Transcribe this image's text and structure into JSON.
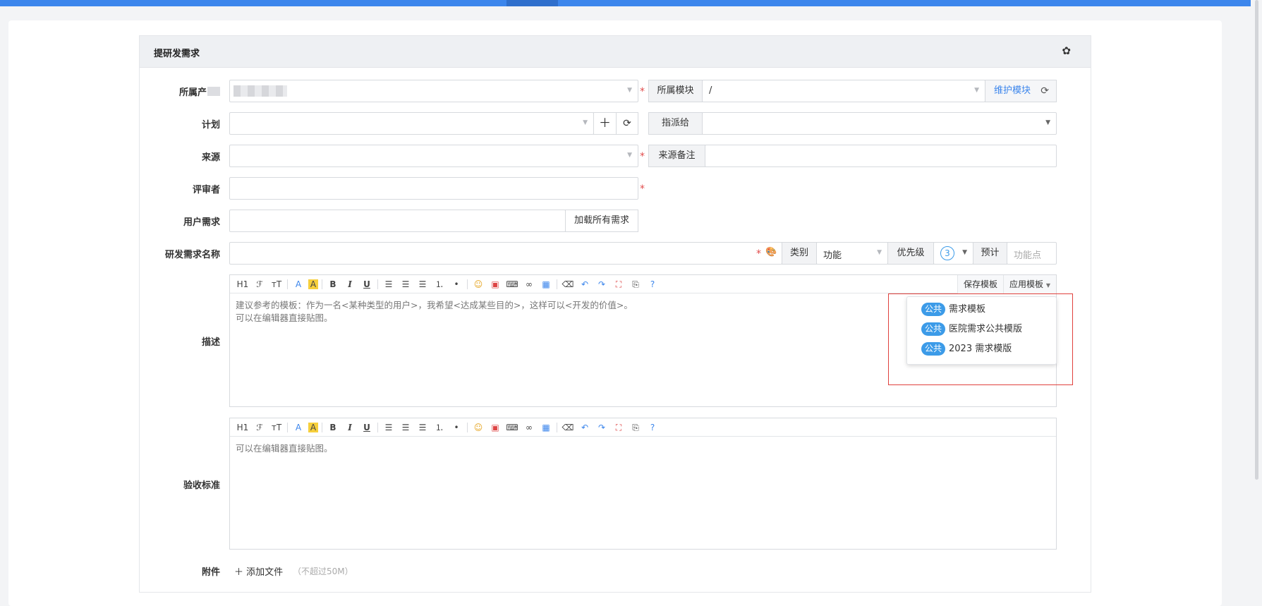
{
  "form": {
    "title": "提研发需求",
    "product_label": "所属产",
    "module_label": "所属模块",
    "module_value": "/",
    "maintain_module": "维护模块",
    "plan_label": "计划",
    "assign_label": "指派给",
    "source_label": "来源",
    "source_note_label": "来源备注",
    "reviewer_label": "评审者",
    "user_req_label": "用户需求",
    "load_all_req": "加载所有需求",
    "name_label": "研发需求名称",
    "category_label": "类别",
    "category_value": "功能",
    "priority_label": "优先级",
    "priority_value": "3",
    "estimate_label": "预计",
    "estimate_placeholder": "功能点",
    "desc_label": "描述",
    "desc_text_1": "建议参考的模板：作为一名<某种类型的用户>，我希望<达成某些目的>，这样可以<开发的价值>。",
    "desc_text_2": "可以在编辑器直接贴图。",
    "save_template": "保存模板",
    "apply_template": "应用模板",
    "accept_label": "验收标准",
    "accept_text": "可以在编辑器直接贴图。",
    "attach_label": "附件",
    "add_file": "添加文件",
    "add_file_hint": "（不超过50M）"
  },
  "template_menu": [
    {
      "badge": "公共",
      "name": "需求模板"
    },
    {
      "badge": "公共",
      "name": "医院需求公共模版"
    },
    {
      "badge": "公共",
      "name": "2023 需求模版"
    }
  ],
  "toolbar": {
    "h1": "H1",
    "font": "ℱ",
    "size": "тT",
    "color": "A",
    "bg": "A",
    "bold": "B",
    "italic": "I",
    "underline": "U"
  },
  "icons": {
    "gear": "gear-icon",
    "plus": "plus-icon",
    "refresh": "refresh-icon",
    "palette": "palette-icon"
  },
  "colors": {
    "accent": "#3c86ec",
    "badge": "#3c9be8",
    "required": "#e14d4d",
    "highlight_box": "#e0413d"
  }
}
